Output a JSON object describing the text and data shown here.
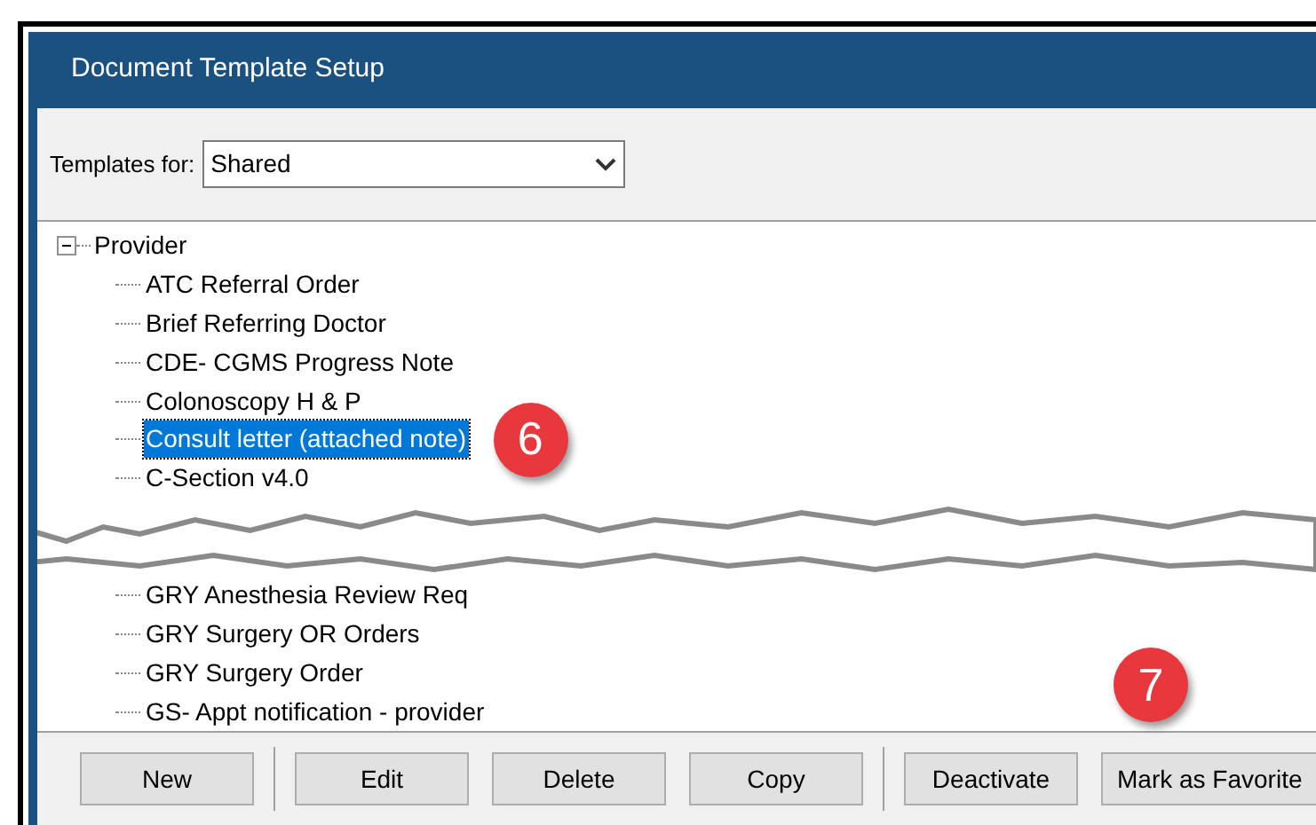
{
  "window": {
    "title": "Document Template Setup"
  },
  "templates_for": {
    "label": "Templates for:",
    "value": "Shared"
  },
  "tree": {
    "label": "Provider",
    "expanded": true,
    "children": [
      {
        "kind": "item",
        "label": "ATC Referral Order",
        "selected": false
      },
      {
        "kind": "item",
        "label": "Brief Referring Doctor",
        "selected": false
      },
      {
        "kind": "item",
        "label": "CDE- CGMS Progress Note",
        "selected": false
      },
      {
        "kind": "item",
        "label": "Colonoscopy H & P",
        "selected": false
      },
      {
        "kind": "item",
        "label": "Consult letter (attached note)",
        "selected": true
      },
      {
        "kind": "item",
        "label": "C-Section v4.0",
        "selected": false
      },
      {
        "kind": "tear"
      },
      {
        "kind": "item",
        "label": "GRY Anesthesia Review Req",
        "selected": false
      },
      {
        "kind": "item",
        "label": "GRY Surgery OR Orders",
        "selected": false
      },
      {
        "kind": "item",
        "label": "GRY Surgery Order",
        "selected": false
      },
      {
        "kind": "item",
        "label": "GS- Appt notification - provider",
        "selected": false
      }
    ]
  },
  "buttons": [
    {
      "label": "New",
      "group_end": true
    },
    {
      "label": "Edit",
      "group_end": false
    },
    {
      "label": "Delete",
      "group_end": false
    },
    {
      "label": "Copy",
      "group_end": true
    },
    {
      "label": "Deactivate",
      "group_end": false
    },
    {
      "label": "Mark as Favorite",
      "group_end": false
    }
  ],
  "callouts": [
    {
      "label": "6"
    },
    {
      "label": "7"
    }
  ]
}
